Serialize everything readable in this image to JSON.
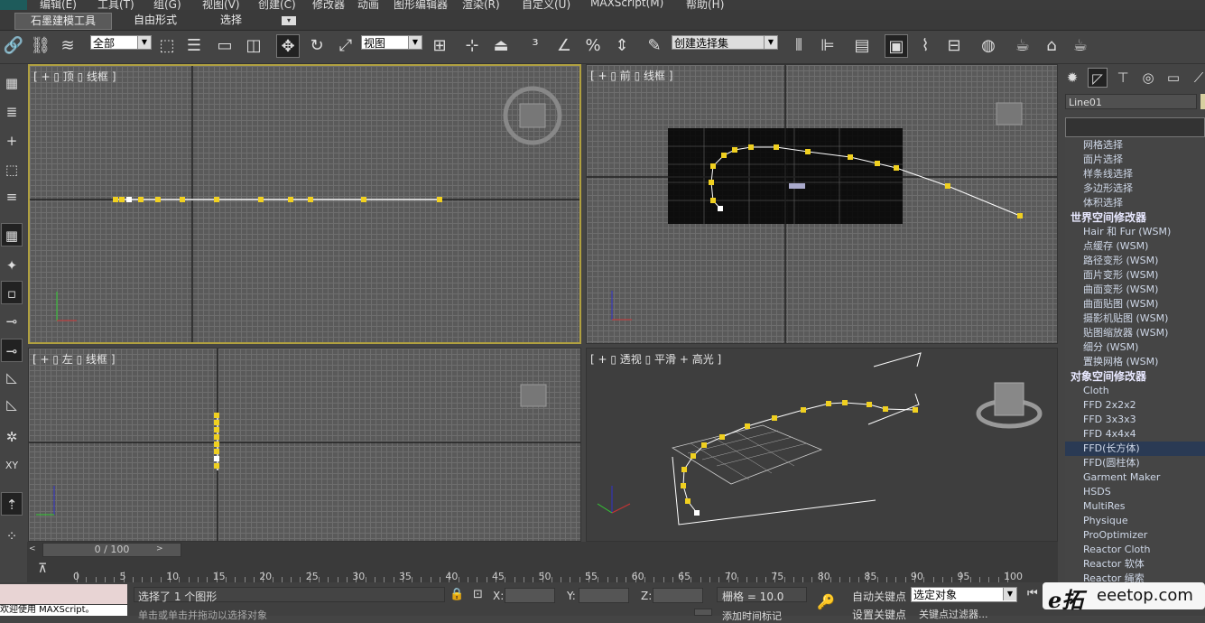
{
  "menu": [
    "编辑(E)",
    "工具(T)",
    "组(G)",
    "视图(V)",
    "创建(C)",
    "修改器",
    "动画",
    "图形编辑器",
    "渲染(R)",
    "自定义(U)",
    "MAXScript(M)",
    "帮助(H)"
  ],
  "ribbon": {
    "tabs": [
      "石墨建模工具",
      "自由形式",
      "选择"
    ]
  },
  "toolbar": {
    "filter_value": "全部",
    "coord_value": "视图",
    "selection_set_placeholder": "创建选择集"
  },
  "viewports": {
    "top": {
      "label": "[ + ▯ 顶 ▯ 线框 ]"
    },
    "front": {
      "label": "[ + ▯ 前 ▯ 线框 ]"
    },
    "left": {
      "label": "[ + ▯ 左 ▯ 线框 ]"
    },
    "persp": {
      "label": "[ + ▯ 透视 ▯ 平滑 + 高光 ]"
    }
  },
  "command_panel": {
    "object_name": "Line01",
    "modifiers": [
      {
        "label": "网格选择",
        "kind": "item"
      },
      {
        "label": "面片选择",
        "kind": "item"
      },
      {
        "label": "样条线选择",
        "kind": "item"
      },
      {
        "label": "多边形选择",
        "kind": "item"
      },
      {
        "label": "体积选择",
        "kind": "item"
      },
      {
        "label": "世界空间修改器",
        "kind": "header"
      },
      {
        "label": "Hair 和 Fur (WSM)",
        "kind": "item"
      },
      {
        "label": "点缓存 (WSM)",
        "kind": "item"
      },
      {
        "label": "路径变形 (WSM)",
        "kind": "item"
      },
      {
        "label": "面片变形 (WSM)",
        "kind": "item"
      },
      {
        "label": "曲面变形 (WSM)",
        "kind": "item"
      },
      {
        "label": "曲面贴图 (WSM)",
        "kind": "item"
      },
      {
        "label": "摄影机贴图 (WSM)",
        "kind": "item"
      },
      {
        "label": "贴图缩放器 (WSM)",
        "kind": "item"
      },
      {
        "label": "细分 (WSM)",
        "kind": "item"
      },
      {
        "label": "置换网格 (WSM)",
        "kind": "item"
      },
      {
        "label": "对象空间修改器",
        "kind": "header"
      },
      {
        "label": "Cloth",
        "kind": "item"
      },
      {
        "label": "FFD 2x2x2",
        "kind": "item"
      },
      {
        "label": "FFD 3x3x3",
        "kind": "item"
      },
      {
        "label": "FFD 4x4x4",
        "kind": "item"
      },
      {
        "label": "FFD(长方体)",
        "kind": "selected"
      },
      {
        "label": "FFD(圆柱体)",
        "kind": "item"
      },
      {
        "label": "Garment Maker",
        "kind": "item"
      },
      {
        "label": "HSDS",
        "kind": "item"
      },
      {
        "label": "MultiRes",
        "kind": "item"
      },
      {
        "label": "Physique",
        "kind": "item"
      },
      {
        "label": "ProOptimizer",
        "kind": "item"
      },
      {
        "label": "Reactor Cloth",
        "kind": "item"
      },
      {
        "label": "Reactor 软体",
        "kind": "item"
      },
      {
        "label": "Reactor 绳索",
        "kind": "item"
      }
    ]
  },
  "timeline": {
    "slider_label": "0 / 100",
    "ticks": [
      "0",
      "5",
      "10",
      "15",
      "20",
      "25",
      "30",
      "35",
      "40",
      "45",
      "50",
      "55",
      "60",
      "65",
      "70",
      "75",
      "80",
      "85",
      "90",
      "95",
      "100"
    ]
  },
  "status": {
    "maxscript_label": "欢迎使用 MAXScript。",
    "selection_text": "选择了 1 个图形",
    "prompt_text": "单击或单击并拖动以选择对象",
    "x_label": "X:",
    "y_label": "Y:",
    "z_label": "Z:",
    "grid_text": "栅格 = 10.0",
    "autokey_label": "自动关键点",
    "setkey_label": "设置关键点",
    "selected_object": "选定对象",
    "add_time_tag": "添加时间标记",
    "key_filter": "关键点过滤器..."
  },
  "watermark": "eeetop.com",
  "colors": {
    "spline_vertex": "#f0d020",
    "active_border": "#b0a040"
  }
}
